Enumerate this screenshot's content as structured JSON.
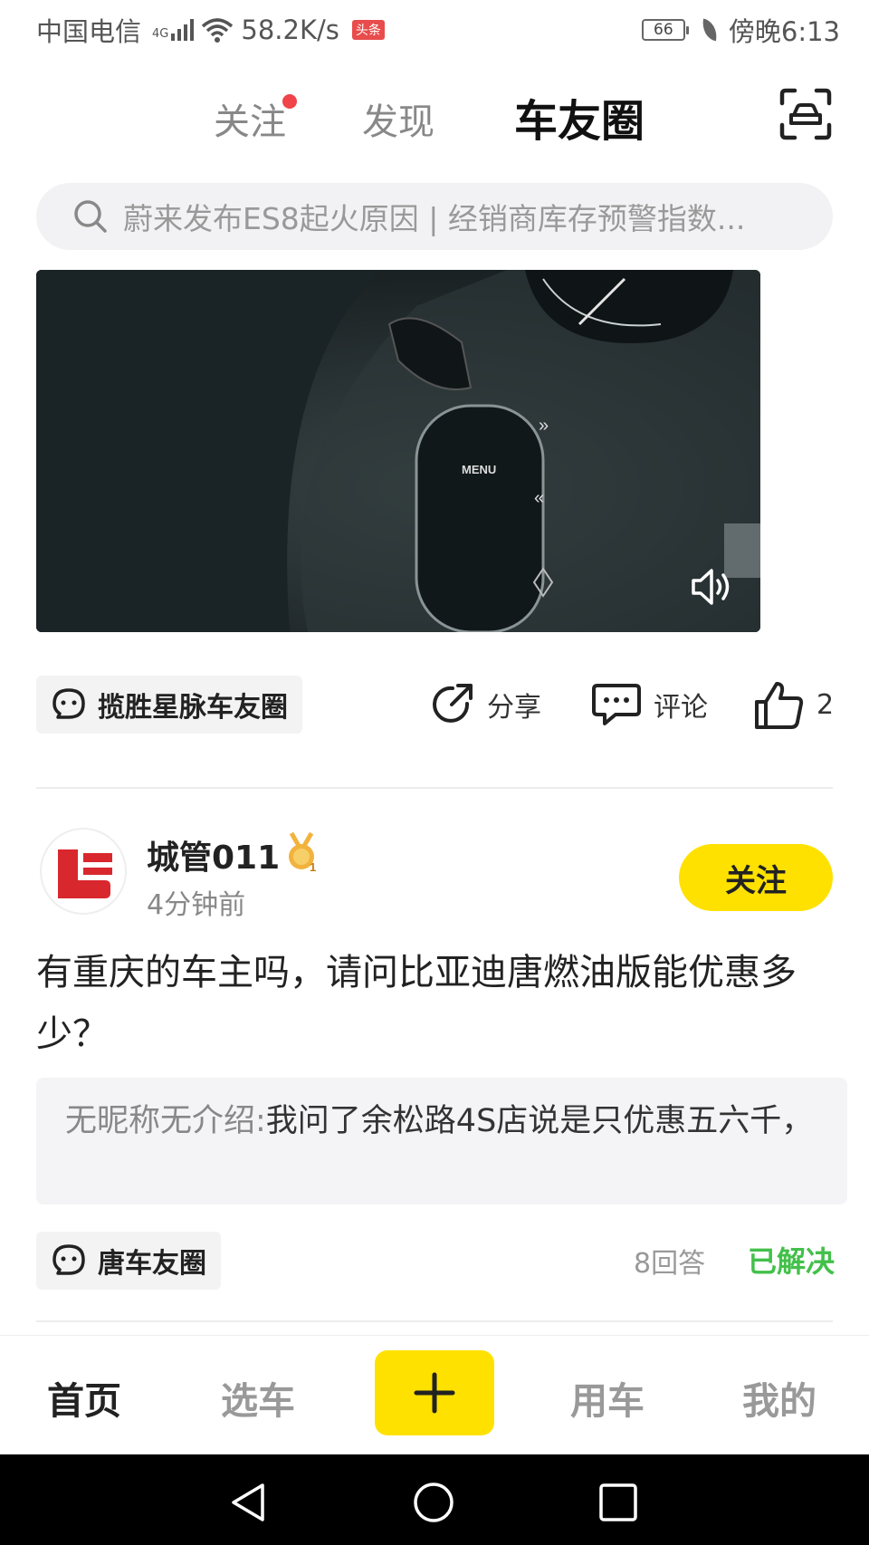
{
  "status_bar": {
    "carrier": "中国电信",
    "network_type": "4G",
    "speed": "58.2K/s",
    "news_badge": "头条",
    "battery": "66",
    "time": "傍晚6:13"
  },
  "top_nav": {
    "tabs": [
      {
        "label": "关注",
        "has_dot": true
      },
      {
        "label": "发现"
      },
      {
        "label": "车友圈",
        "active": true
      }
    ],
    "scan_icon": "car-scan-icon"
  },
  "search": {
    "placeholder": "蔚来发布ES8起火原因 | 经销商库存预警指数..."
  },
  "video_post": {
    "circle_tag": "揽胜星脉车友圈",
    "actions": {
      "share": "分享",
      "comment": "评论",
      "like_count": "2"
    }
  },
  "question_post": {
    "username": "城管011",
    "medal_level": "1",
    "time": "4分钟前",
    "follow_label": "关注",
    "title": "有重庆的车主吗，请问比亚迪唐燃油版能优惠多少？",
    "top_answer": {
      "author": "无昵称无介绍:",
      "text": "我问了余松路4S店说是只优惠五六千，"
    },
    "circle_tag": "唐车友圈",
    "answer_count": "8回答",
    "status": "已解决",
    "status_color": "#43c04a"
  },
  "bottom_tabs": [
    {
      "label": "首页",
      "active": true
    },
    {
      "label": "选车"
    },
    {
      "label": "+"
    },
    {
      "label": "用车"
    },
    {
      "label": "我的"
    }
  ],
  "colors": {
    "accent": "#ffe100",
    "red_dot": "#f0434a"
  }
}
